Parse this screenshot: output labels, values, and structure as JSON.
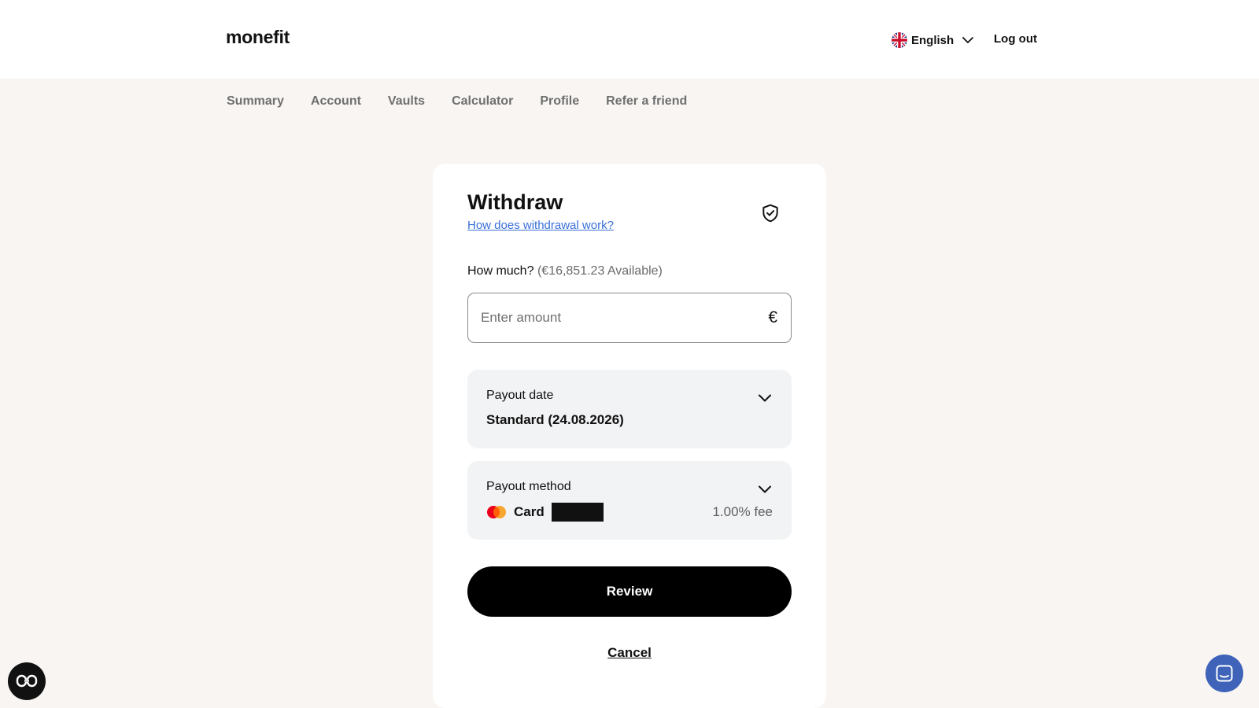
{
  "header": {
    "logo": "monefit",
    "language": {
      "label": "English",
      "flag_icon": "uk-flag-icon"
    },
    "logout_label": "Log out"
  },
  "nav": {
    "items": [
      {
        "label": "Summary"
      },
      {
        "label": "Account"
      },
      {
        "label": "Vaults"
      },
      {
        "label": "Calculator"
      },
      {
        "label": "Profile"
      },
      {
        "label": "Refer a friend"
      }
    ]
  },
  "withdraw": {
    "title": "Withdraw",
    "help_link": "How does withdrawal work?",
    "amount_label": "How much?",
    "available": "(€16,851.23 Available)",
    "amount_placeholder": "Enter amount",
    "amount_value": "",
    "currency_symbol": "€",
    "payout_date": {
      "label": "Payout date",
      "value": "Standard (24.08.2026)"
    },
    "payout_method": {
      "label": "Payout method",
      "method": "Card",
      "card_icon": "mastercard-icon",
      "fee": "1.00% fee"
    },
    "review_label": "Review",
    "cancel_label": "Cancel"
  },
  "colors": {
    "page_bg": "#f8f5f2",
    "link": "#3a6fd8",
    "primary_button": "#000000",
    "chat_button": "#3e63b8"
  }
}
